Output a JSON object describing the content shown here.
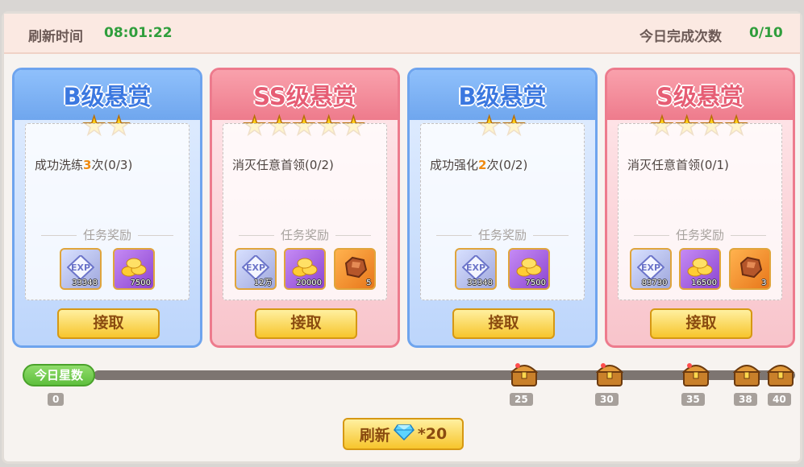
{
  "header": {
    "refresh_label": "刷新时间",
    "refresh_time": "08:01:22",
    "completed_label": "今日完成次数",
    "completed_value": "0/10"
  },
  "cards": [
    {
      "grade": "B级悬赏",
      "color": "blue",
      "stars": 2,
      "task_prefix": "成功洗练",
      "task_num": "3",
      "task_suffix": "次(0/3)",
      "reward_title": "任务奖励",
      "rewards": [
        {
          "icon": "exp-crystal-icon",
          "qty": "33348"
        },
        {
          "icon": "gold-coins-icon",
          "qty": "7500"
        }
      ],
      "button": "接取"
    },
    {
      "grade": "SS级悬赏",
      "color": "red",
      "stars": 5,
      "task_prefix": "消灭任意首领(0/2)",
      "task_num": "",
      "task_suffix": "",
      "reward_title": "任务奖励",
      "rewards": [
        {
          "icon": "exp-crystal-icon",
          "qty": "12万"
        },
        {
          "icon": "gold-coins-icon",
          "qty": "20000"
        },
        {
          "icon": "ore-icon",
          "qty": "5"
        }
      ],
      "button": "接取"
    },
    {
      "grade": "B级悬赏",
      "color": "blue",
      "stars": 2,
      "task_prefix": "成功强化",
      "task_num": "2",
      "task_suffix": "次(0/2)",
      "reward_title": "任务奖励",
      "rewards": [
        {
          "icon": "exp-crystal-icon",
          "qty": "33348"
        },
        {
          "icon": "gold-coins-icon",
          "qty": "7500"
        }
      ],
      "button": "接取"
    },
    {
      "grade": "S级悬赏",
      "color": "red",
      "stars": 4,
      "task_prefix": "消灭任意首领(0/1)",
      "task_num": "",
      "task_suffix": "",
      "reward_title": "任务奖励",
      "rewards": [
        {
          "icon": "exp-crystal-icon",
          "qty": "83730"
        },
        {
          "icon": "gold-coins-icon",
          "qty": "16500"
        },
        {
          "icon": "ore-icon",
          "qty": "3"
        }
      ],
      "button": "接取"
    }
  ],
  "progress": {
    "label": "今日星数",
    "current": "0",
    "milestones": [
      "25",
      "30",
      "35",
      "38",
      "40"
    ]
  },
  "refresh_button": {
    "label": "刷新",
    "cost": "*20",
    "icon": "diamond-icon"
  },
  "colors": {
    "blue_card": "#6ea4ee",
    "red_card": "#ed7b8d",
    "green_text": "#2f9e3c",
    "button_gold": "#f7c52c"
  }
}
